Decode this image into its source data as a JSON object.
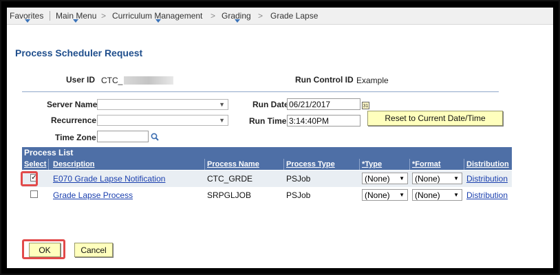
{
  "breadcrumb": {
    "favorites": "Favorites",
    "main_menu": "Main Menu",
    "curriculum": "Curriculum Management",
    "grading": "Grading",
    "current": "Grade Lapse",
    "separator": ">"
  },
  "page_title": "Process Scheduler Request",
  "user_id": {
    "label": "User ID",
    "value": "CTC_"
  },
  "run_control": {
    "label": "Run Control ID",
    "value": "Example"
  },
  "server_name": {
    "label": "Server Name",
    "value": ""
  },
  "recurrence": {
    "label": "Recurrence",
    "value": ""
  },
  "time_zone": {
    "label": "Time Zone",
    "value": ""
  },
  "run_date": {
    "label": "Run Date",
    "value": "06/21/2017"
  },
  "run_time": {
    "label": "Run Time",
    "value": "3:14:40PM"
  },
  "reset_button": "Reset to Current Date/Time",
  "process_list": {
    "title": "Process List",
    "columns": [
      "Select",
      "Description",
      "Process Name",
      "Process Type",
      "*Type",
      "*Format",
      "Distribution"
    ],
    "rows": [
      {
        "selected": true,
        "description": "E070 Grade Lapse Notification",
        "process_name": "CTC_GRDE",
        "process_type": "PSJob",
        "type": "(None)",
        "format": "(None)",
        "distribution": "Distribution"
      },
      {
        "selected": false,
        "description": "Grade Lapse Process",
        "process_name": "SRPGLJOB",
        "process_type": "PSJob",
        "type": "(None)",
        "format": "(None)",
        "distribution": "Distribution"
      }
    ]
  },
  "ok_button": "OK",
  "cancel_button": "Cancel",
  "colors": {
    "header_bg": "#4e6fa6",
    "title": "#1f4e8c",
    "button_bg": "#ffffbd",
    "highlight": "#e24a4a",
    "link": "#1a3fae"
  }
}
